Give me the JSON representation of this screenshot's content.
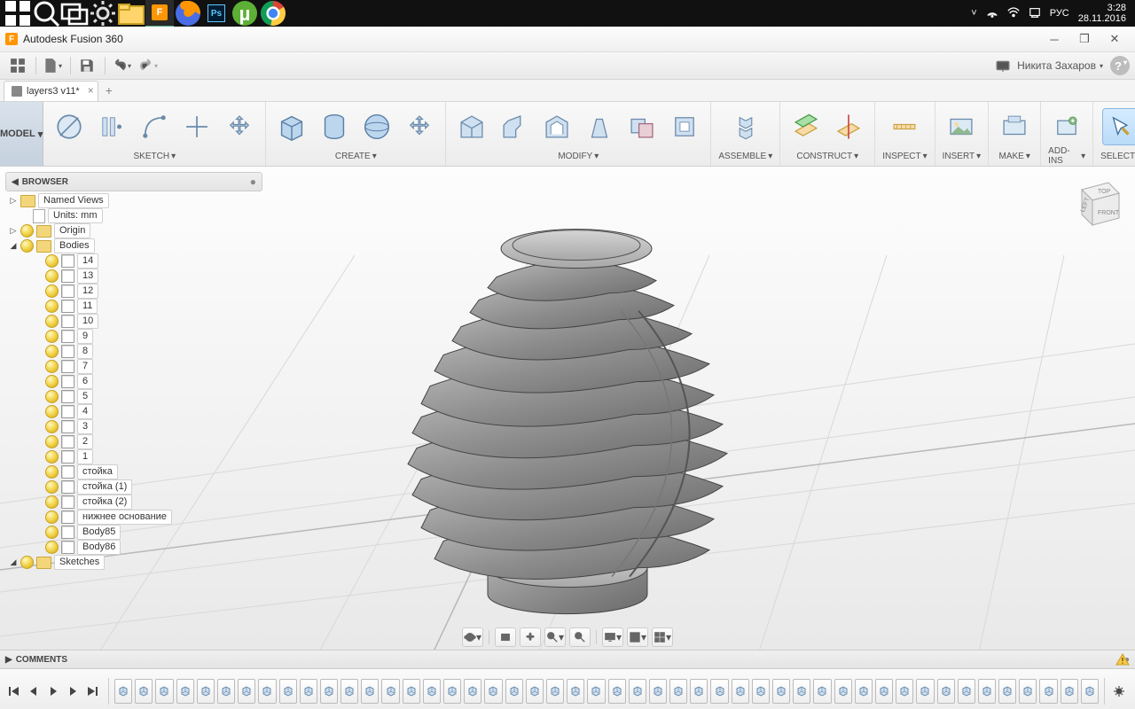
{
  "taskbar": {
    "lang": "РУС",
    "time": "3:28",
    "date": "28.11.2016"
  },
  "titlebar": {
    "app_name": "Autodesk Fusion 360"
  },
  "qat": {
    "user_name": "Никита Захаров"
  },
  "doctab": {
    "name": "layers3 v11*"
  },
  "ribbon": {
    "mode": "MODEL",
    "groups": {
      "sketch": "SKETCH",
      "create": "CREATE",
      "modify": "MODIFY",
      "assemble": "ASSEMBLE",
      "construct": "CONSTRUCT",
      "inspect": "INSPECT",
      "insert": "INSERT",
      "make": "MAKE",
      "addins": "ADD-INS",
      "select": "SELECT"
    }
  },
  "browser": {
    "title": "BROWSER",
    "named_views": "Named Views",
    "units": "Units: mm",
    "origin": "Origin",
    "bodies": "Bodies",
    "body_items": [
      "14",
      "13",
      "12",
      "11",
      "10",
      "9",
      "8",
      "7",
      "6",
      "5",
      "4",
      "3",
      "2",
      "1",
      "стойка",
      "стойка (1)",
      "стойка (2)",
      "нижнее основание",
      "Body85",
      "Body86"
    ],
    "sketches": "Sketches"
  },
  "comments": {
    "title": "COMMENTS"
  },
  "viewcube": {
    "top": "TOP",
    "left": "LEFT",
    "front": "FRONT"
  },
  "timeline": {
    "item_count": 48
  }
}
